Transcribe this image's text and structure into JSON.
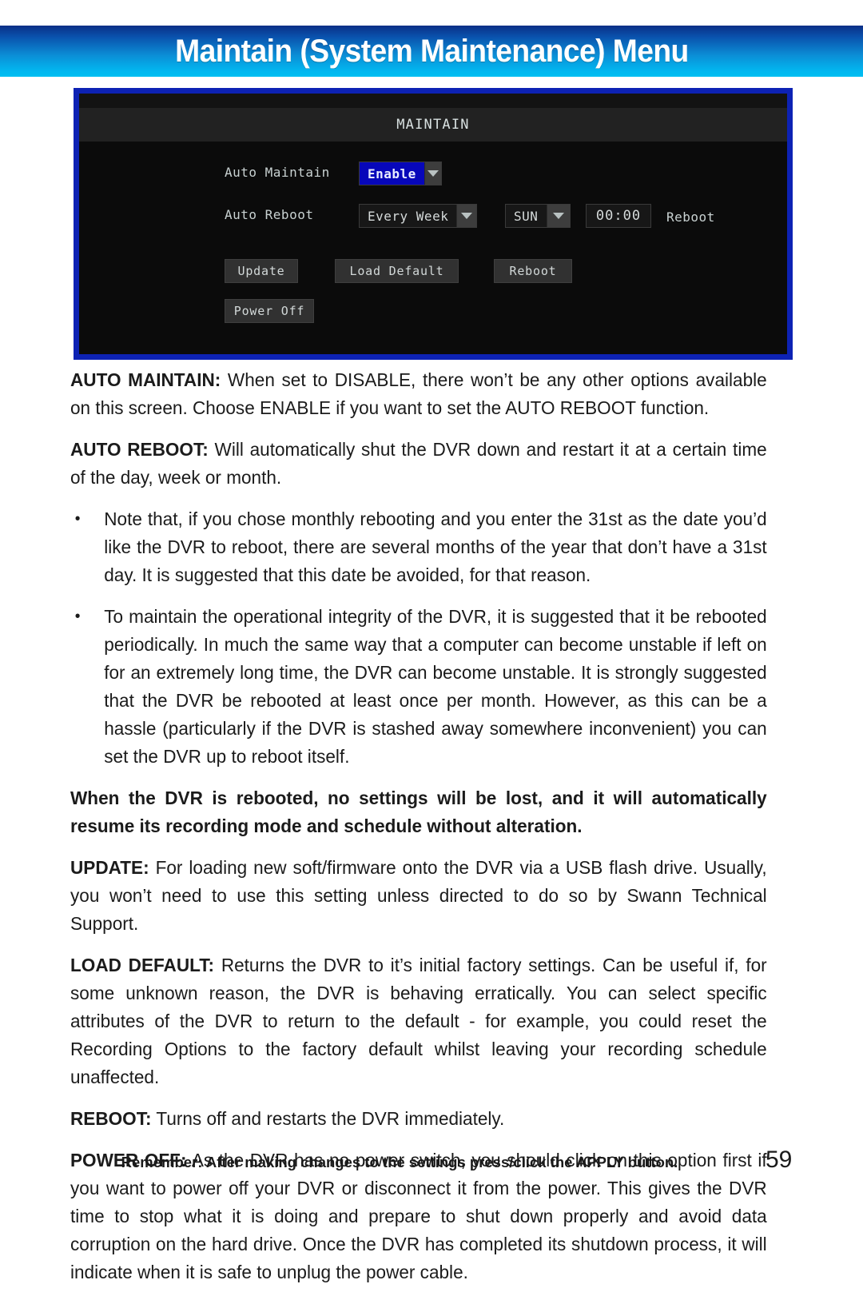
{
  "header": {
    "title": "Maintain (System Maintenance) Menu",
    "gradient_top": "#0b2f86",
    "gradient_bottom": "#00bff2"
  },
  "dvr_screenshot": {
    "border_color": "#0d22b4",
    "background_color": "#0b0b0b",
    "title": "MAINTAIN",
    "rows": [
      {
        "label": "Auto  Maintain",
        "control": "dropdown",
        "value": "Enable",
        "highlighted": true,
        "highlight_color": "#0707ba"
      },
      {
        "label": "Auto  Reboot",
        "control": "dropdown-group",
        "cycle_value": "Every  Week",
        "day_value": "SUN",
        "time_value": "00:00",
        "trailing_label": "Reboot"
      }
    ],
    "buttons": [
      {
        "label": "Update"
      },
      {
        "label": "Load Default"
      },
      {
        "label": "Reboot"
      },
      {
        "label": "Power Off"
      }
    ]
  },
  "content": {
    "paragraphs": [
      {
        "id": "auto-maintain",
        "lead": "AUTO MAINTAIN:",
        "text": " When set to DISABLE, there won’t be any other options available on this screen. Choose ENABLE if you want to set the AUTO REBOOT function."
      },
      {
        "id": "auto-reboot",
        "lead": "AUTO REBOOT:",
        "text": " Will automatically shut the DVR down and restart it at a certain time of the day, week or month."
      }
    ],
    "bullets": [
      {
        "id": "bullet-monthly-reboot",
        "mark": "•",
        "text": "Note that, if you chose monthly rebooting and you enter the 31st as the date you’d like the DVR to reboot, there are several months of the year that don’t have a 31st day. It is suggested that this date be avoided, for that reason."
      },
      {
        "id": "bullet-operational-integrity",
        "mark": "•",
        "text": "To maintain the operational integrity of the DVR, it is suggested that it be rebooted periodically. In much the same way that a computer can become unstable if left on for an extremely long time, the DVR can become unstable. It is strongly suggested that the DVR be rebooted at least once per month. However, as this can be a hassle (particularly if the DVR is stashed away somewhere inconvenient) you can set the DVR up to reboot itself."
      }
    ],
    "bold_note": "When the DVR is rebooted, no settings will be lost, and it will automatically resume its recording mode and schedule without alteration.",
    "paragraphs2": [
      {
        "id": "update",
        "lead": "UPDATE:",
        "text": " For loading new soft/firmware onto the DVR via a USB flash drive. Usually, you won’t need to use this setting unless directed to do so by Swann Technical Support."
      },
      {
        "id": "load-default",
        "lead": "LOAD DEFAULT:",
        "text": " Returns the DVR to it’s initial factory settings. Can be useful if, for some unknown reason, the DVR is behaving erratically. You can select specific attributes of the DVR to return to the default - for example, you could reset the Recording Options to the factory default whilst leaving your recording schedule unaffected."
      },
      {
        "id": "reboot",
        "lead": "REBOOT:",
        "text": " Turns off and restarts the DVR immediately."
      },
      {
        "id": "power-off",
        "lead": "POWER OFF:",
        "text": " As the DVR has no power switch, you should click on this option first if you want to power off your DVR or disconnect it from the power. This gives the DVR time to stop what it is doing and prepare to shut down properly and avoid data corruption on the hard drive. Once the DVR has completed its shutdown process, it will indicate when it is safe to unplug the power cable."
      }
    ]
  },
  "footer": {
    "note": "Remember: After making changes to the settings press/click the APPLY button.",
    "page_number": "59"
  }
}
